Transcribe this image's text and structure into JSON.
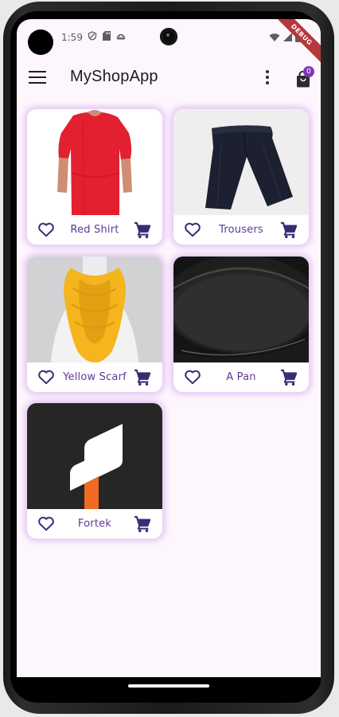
{
  "status_bar": {
    "time": "1:59",
    "debug_banner": "DEBUG"
  },
  "app_bar": {
    "title": "MyShopApp",
    "cart_count": "0"
  },
  "products": [
    {
      "title": "Red Shirt"
    },
    {
      "title": "Trousers"
    },
    {
      "title": "Yellow Scarf"
    },
    {
      "title": "A Pan"
    },
    {
      "title": "Fortek"
    }
  ],
  "colors": {
    "accent": "#5c3a96",
    "badge": "#7b3ab0",
    "background": "#fdf6fd",
    "card_glow": "#ce96eb",
    "debug_ribbon": "#b5383b"
  },
  "icons": {
    "menu": "hamburger-icon",
    "more": "more-vert-icon",
    "cart": "shopping-bag-icon",
    "favorite": "heart-outline-icon",
    "add_to_cart": "cart-icon"
  }
}
